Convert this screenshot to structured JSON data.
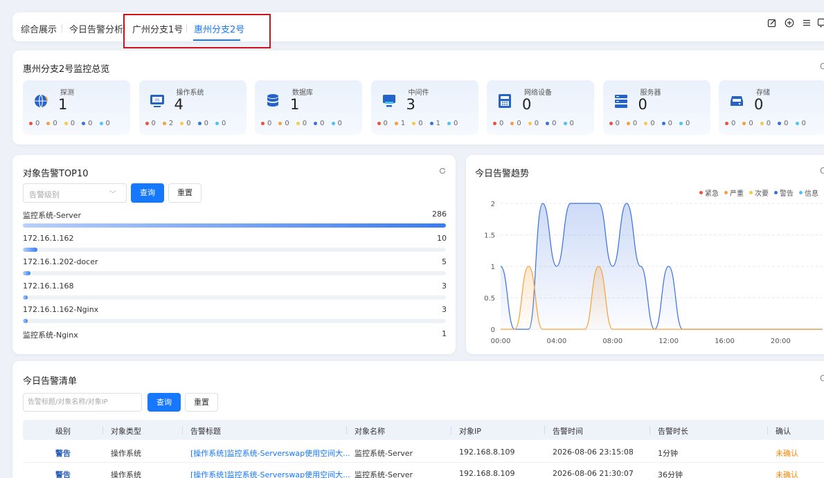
{
  "tabs": [
    {
      "label": "综合展示",
      "active": false
    },
    {
      "label": "今日告警分析",
      "active": false
    },
    {
      "label": "广州分支1号",
      "active": false
    },
    {
      "label": "惠州分支2号",
      "active": true
    }
  ],
  "toolbar_icons": [
    "edit-icon",
    "add-circle-icon",
    "menu-icon",
    "window-icon"
  ],
  "overview": {
    "title": "惠州分支2号监控总览",
    "cards": [
      {
        "label": "探测",
        "value": "1",
        "icon": "globe-icon",
        "counts": [
          "0",
          "0",
          "0",
          "0",
          "0"
        ]
      },
      {
        "label": "操作系统",
        "value": "4",
        "icon": "os-icon",
        "counts": [
          "0",
          "2",
          "0",
          "0",
          "0"
        ]
      },
      {
        "label": "数据库",
        "value": "1",
        "icon": "database-icon",
        "counts": [
          "0",
          "0",
          "0",
          "0",
          "0"
        ]
      },
      {
        "label": "中间件",
        "value": "3",
        "icon": "middleware-icon",
        "counts": [
          "0",
          "1",
          "0",
          "1",
          "0"
        ]
      },
      {
        "label": "网络设备",
        "value": "0",
        "icon": "network-device-icon",
        "counts": [
          "0",
          "0",
          "0",
          "0",
          "0"
        ]
      },
      {
        "label": "服务器",
        "value": "0",
        "icon": "server-icon",
        "counts": [
          "0",
          "0",
          "0",
          "0",
          "0"
        ]
      },
      {
        "label": "存储",
        "value": "0",
        "icon": "storage-icon",
        "counts": [
          "0",
          "0",
          "0",
          "0",
          "0"
        ]
      }
    ],
    "severity_colors": [
      "#f0503c",
      "#f5a03c",
      "#f7c948",
      "#3a6fe0",
      "#4cc3f0"
    ]
  },
  "top10": {
    "title": "对象告警TOP10",
    "select_placeholder": "告警级别",
    "query_label": "查询",
    "reset_label": "重置",
    "max": 286,
    "items": [
      {
        "name": "监控系统-Server",
        "value": 286
      },
      {
        "name": "172.16.1.162",
        "value": 10
      },
      {
        "name": "172.16.1.202-docer",
        "value": 5
      },
      {
        "name": "172.16.1.168",
        "value": 3
      },
      {
        "name": "172.16.1.162-Nginx",
        "value": 3
      },
      {
        "name": "监控系统-Nginx",
        "value": 1
      }
    ]
  },
  "trend": {
    "title": "今日告警趋势",
    "legend": [
      {
        "label": "紧急",
        "color": "#f0503c"
      },
      {
        "label": "严重",
        "color": "#f5a03c"
      },
      {
        "label": "次要",
        "color": "#f7c948"
      },
      {
        "label": "警告",
        "color": "#3a6fe0"
      },
      {
        "label": "信息",
        "color": "#4cc3f0"
      }
    ],
    "chart_data": {
      "type": "area",
      "x_labels": [
        "00:00",
        "04:00",
        "08:00",
        "12:00",
        "16:00",
        "20:00"
      ],
      "y_ticks": [
        0,
        0.5,
        1,
        1.5,
        2
      ],
      "ylim": [
        0,
        2
      ],
      "xlim": [
        0,
        23
      ],
      "series": [
        {
          "name": "警告",
          "color": "#3a6fe0",
          "points": [
            [
              0,
              1
            ],
            [
              1,
              0
            ],
            [
              2,
              0
            ],
            [
              3,
              2
            ],
            [
              4,
              1
            ],
            [
              5,
              2
            ],
            [
              6,
              2
            ],
            [
              7,
              2
            ],
            [
              8,
              1
            ],
            [
              9,
              2
            ],
            [
              10,
              1
            ],
            [
              11,
              0
            ],
            [
              12,
              1
            ],
            [
              13,
              0
            ],
            [
              14,
              0
            ],
            [
              15,
              0
            ],
            [
              16,
              0
            ],
            [
              17,
              0
            ],
            [
              18,
              0
            ],
            [
              19,
              0
            ],
            [
              20,
              0
            ],
            [
              21,
              0
            ],
            [
              22,
              0
            ],
            [
              23,
              0
            ]
          ]
        },
        {
          "name": "严重",
          "color": "#f5a03c",
          "points": [
            [
              0,
              0
            ],
            [
              1,
              0
            ],
            [
              2,
              1
            ],
            [
              3,
              0
            ],
            [
              4,
              0
            ],
            [
              5,
              0
            ],
            [
              6,
              0
            ],
            [
              7,
              1
            ],
            [
              8,
              0
            ],
            [
              9,
              0
            ],
            [
              10,
              0
            ],
            [
              11,
              0
            ],
            [
              12,
              0
            ],
            [
              13,
              0
            ],
            [
              14,
              0
            ],
            [
              15,
              0
            ],
            [
              16,
              0
            ],
            [
              17,
              0
            ],
            [
              18,
              0
            ],
            [
              19,
              0
            ],
            [
              20,
              0
            ],
            [
              21,
              0
            ],
            [
              22,
              0
            ],
            [
              23,
              0
            ]
          ]
        }
      ]
    }
  },
  "alerts": {
    "title": "今日告警清单",
    "search_placeholder": "告警标题/对象名称/对象IP",
    "query_label": "查询",
    "reset_label": "重置",
    "columns": [
      "级别",
      "对象类型",
      "告警标题",
      "对象名称",
      "对象IP",
      "告警时间",
      "告警时长",
      "确认"
    ],
    "rows": [
      {
        "level": "警告",
        "type": "操作系统",
        "title": "[操作系统]监控系统-Serverswap使用空间大...",
        "object": "监控系统-Server",
        "ip": "192.168.8.109",
        "time": "2026-08-06 23:15:08",
        "duration": "1分钟",
        "confirm": "未确认"
      },
      {
        "level": "警告",
        "type": "操作系统",
        "title": "[操作系统]监控系统-Serverswap使用空间大...",
        "object": "监控系统-Server",
        "ip": "192.168.8.109",
        "time": "2026-08-06 21:30:07",
        "duration": "36分钟",
        "confirm": "未确认"
      }
    ]
  }
}
